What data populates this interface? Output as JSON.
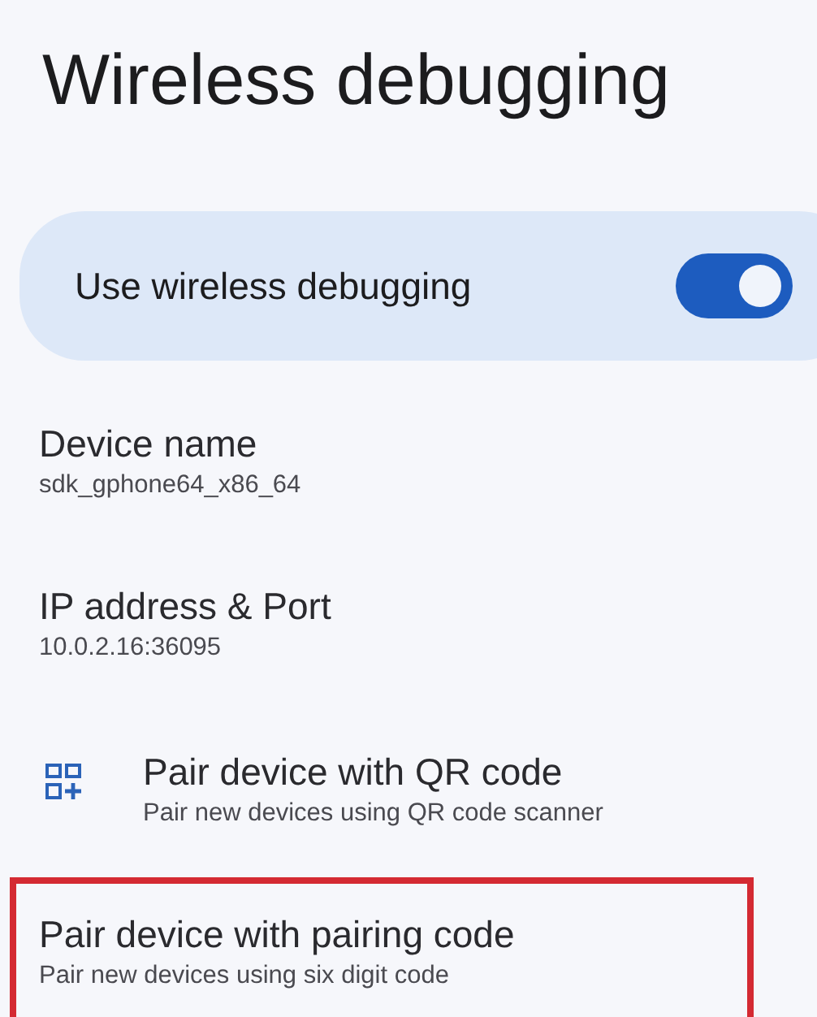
{
  "title": "Wireless debugging",
  "main_switch": {
    "label": "Use wireless debugging",
    "on": true
  },
  "items": [
    {
      "kind": "info",
      "title": "Device name",
      "subtitle": "sdk_gphone64_x86_64",
      "highlighted": false
    },
    {
      "kind": "info",
      "title": "IP address & Port",
      "subtitle": "10.0.2.16:36095",
      "highlighted": false
    },
    {
      "kind": "qr",
      "title": "Pair device with QR code",
      "subtitle": "Pair new devices using QR code scanner",
      "highlighted": false
    },
    {
      "kind": "info",
      "title": "Pair device with pairing code",
      "subtitle": "Pair new devices using six digit code",
      "highlighted": true
    }
  ]
}
